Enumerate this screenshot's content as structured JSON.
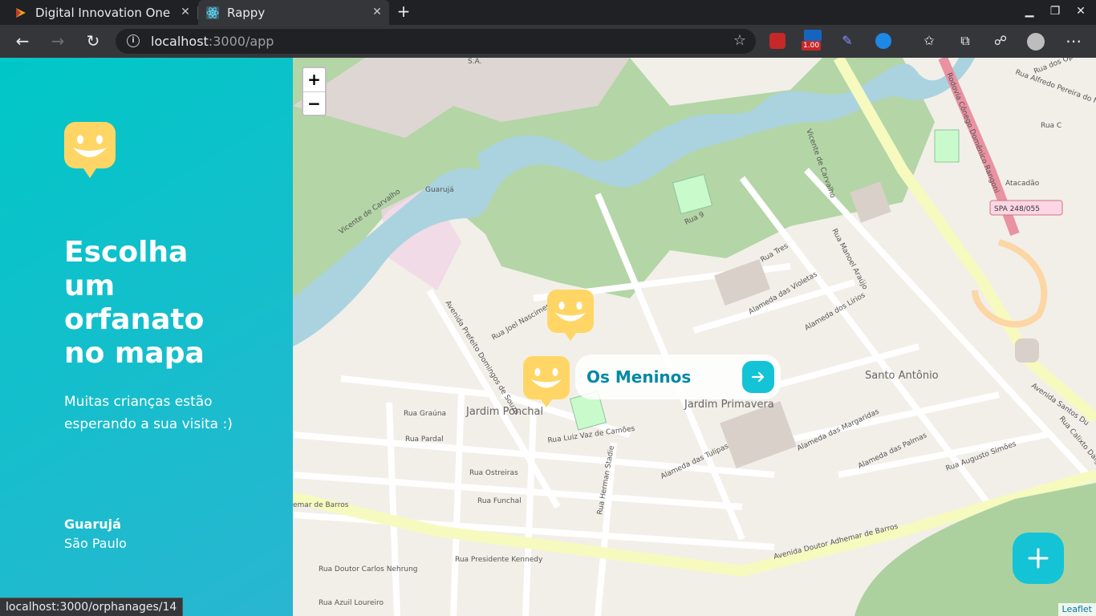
{
  "browser": {
    "tabs": [
      {
        "title": "Digital Innovation One",
        "active": false
      },
      {
        "title": "Rappy",
        "active": true
      }
    ],
    "url_host": "localhost",
    "url_rest": ":3000/app",
    "zoom_badge": "1.00",
    "status_url": "localhost:3000/orphanages/14"
  },
  "sidebar": {
    "headline": "Escolha um orfanato no mapa",
    "subtitle": "Muitas crianças estão esperando a sua visita :)",
    "city": "Guarujá",
    "state": "São Paulo"
  },
  "map": {
    "zoom_in": "+",
    "zoom_out": "−",
    "popup_name": "Os Meninos",
    "attribution": "Leaflet",
    "labels": {
      "sa": "S.A.",
      "guaruja": "Guarujá",
      "vicente1": "Vicente de Carvalho",
      "vicente2": "Vicente de Carvalho",
      "jardim_ponchal": "Jardim Ponchal",
      "jardim_primavera": "Jardim Primavera",
      "santo_antonio": "Santo Antônio",
      "atacadao": "Atacadão",
      "spa": "SPA 248/055",
      "rodovia": "Rodovia Cônego Domênico Rangoni",
      "adhemar": "Avenida Doutor Adhemar de Barros",
      "adhemar_left": "emar de Barros",
      "santos_dumont": "Avenida Santos Du",
      "prefeito": "Avenida Prefeito Domingos de Souza",
      "rua_grauna": "Rua Graúna",
      "rua_pardal": "Rua Pardal",
      "rua_ostreiras": "Rua Ostreiras",
      "rua_funchal": "Rua Funchal",
      "rua_kennedy": "Rua Presidente Kennedy",
      "rua_nehrung": "Rua Doutor Carlos Nehrung",
      "rua_azuil": "Rua Azuil Loureiro",
      "rua_luiz": "Rua Luiz Vaz de Camões",
      "rua_tulipas": "Alameda das Tulipas",
      "rua_violetas": "Alameda das Violetas",
      "rua_lirios": "Alameda dos Lírios",
      "rua_margaridas": "Alameda das Margaridas",
      "rua_palmas": "Alameda das Palmas",
      "rua_manuel": "Rua Manoel Araújo",
      "rua_augusto": "Rua Augusto Simões",
      "rua_calixto": "Rua Calixto Daige",
      "rua_operarios": "Rua dos Operários",
      "rua_alfredo": "Rua Alfredo Pereira do Nascimento",
      "rua_c": "Rua C",
      "rua_9": "Rua 9",
      "rua_tres": "Rua Tres",
      "rua_joel": "Rua Joel Nascimento",
      "rua_herman": "Rua Herman Stadie"
    }
  },
  "colors": {
    "accent_start": "#00c7c7",
    "accent_end": "#29b6d1",
    "marker": "#ffd666",
    "button": "#15c3d6",
    "popup_text": "#0089a5"
  },
  "icons": {
    "logo": "smile-marker-icon",
    "marker": "smile-marker-icon",
    "arrow": "arrow-right-icon",
    "plus": "plus-icon"
  }
}
